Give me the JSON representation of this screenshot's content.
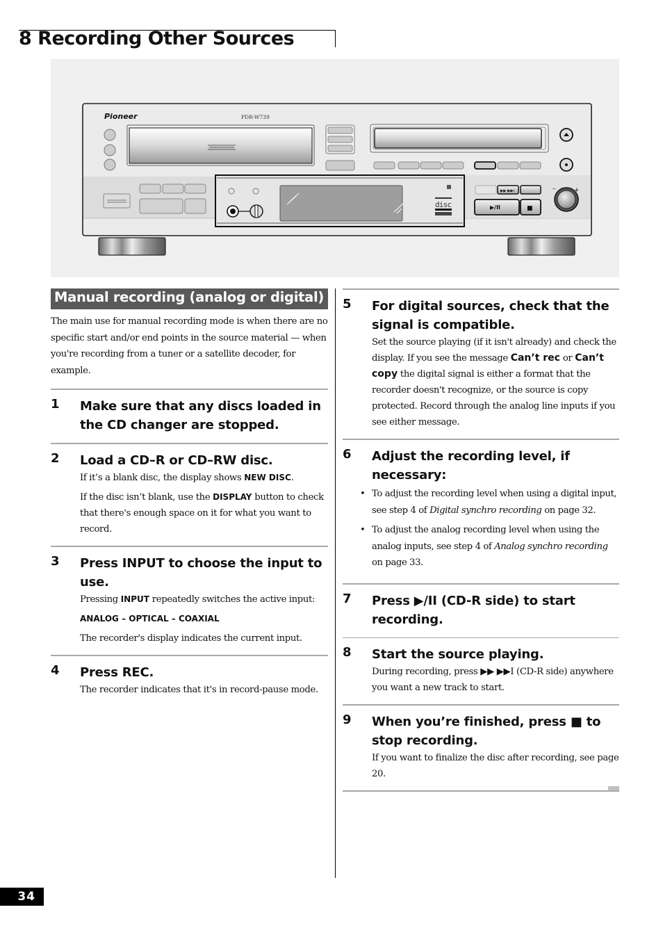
{
  "header": {
    "title": "8 Recording Other Sources"
  },
  "illustration": {
    "brand": "Pioneer",
    "model": "PDR-W739",
    "play_pause_label": "▶/II",
    "stop_label": "■",
    "skip_label": "▶▶ ▶▶I",
    "level_minus": "–",
    "level_plus": "+",
    "disc_logo": "disc"
  },
  "section": {
    "heading": "Manual recording (analog or digital)",
    "intro": "The main use for manual recording mode is when there are no specific start and/or end points in the source material — when you're recording from a tuner or a satellite decoder, for example."
  },
  "steps": [
    {
      "num": "1",
      "title": "Make sure that any discs loaded in the CD changer are stopped."
    },
    {
      "num": "2",
      "title": "Load a CD–R or CD–RW disc.",
      "body1_pre": "If it’s a blank disc, the display shows ",
      "body1_kw": "NEW DISC",
      "body1_post": ".",
      "body2_pre": "If the disc isn’t blank, use the ",
      "body2_kw": "DISPLAY",
      "body2_post": " button to check that there's enough space on it for what you want to record."
    },
    {
      "num": "3",
      "title": "Press INPUT to choose the input to use.",
      "body1_pre": "Pressing ",
      "body1_kw": "INPUT",
      "body1_post": " repeatedly switches the active input:",
      "sequence": "ANALOG – OPTICAL – COAXIAL",
      "body3": "The recorder's display indicates the current input."
    },
    {
      "num": "4",
      "title": "Press REC.",
      "body": "The recorder indicates that it's in record-pause mode."
    },
    {
      "num": "5",
      "title": "For digital sources, check that the signal is compatible.",
      "body_pre": "Set the source playing (if it isn't already) and check the display. If you see the message ",
      "kw1": "Can’t rec",
      "mid": " or ",
      "kw2": "Can’t copy",
      "body_post": " the digital signal is either a format that the recorder doesn't recognize, or the source is copy protected. Record through the analog line inputs if you see either message."
    },
    {
      "num": "6",
      "title": "Adjust the recording level, if necessary:",
      "bullets": [
        {
          "pre": "To adjust the recording level when using a digital input, see step 4 of ",
          "em": "Digital synchro recording",
          "post": " on page 32."
        },
        {
          "pre": "To adjust the analog recording level when using the analog inputs, see step 4 of ",
          "em": "Analog synchro recording",
          "post": " on page 33."
        }
      ]
    },
    {
      "num": "7",
      "title": "Press ▶/II (CD-R side) to start recording."
    },
    {
      "num": "8",
      "title": "Start the source playing.",
      "body": "During recording, press ▶▶ ▶▶I (CD-R side) anywhere you want a new track to start."
    },
    {
      "num": "9",
      "title": "When you’re finished, press ■ to stop recording.",
      "body": "If you want to finalize the disc after recording, see page 20."
    }
  ],
  "footer": {
    "page_number": "34"
  }
}
